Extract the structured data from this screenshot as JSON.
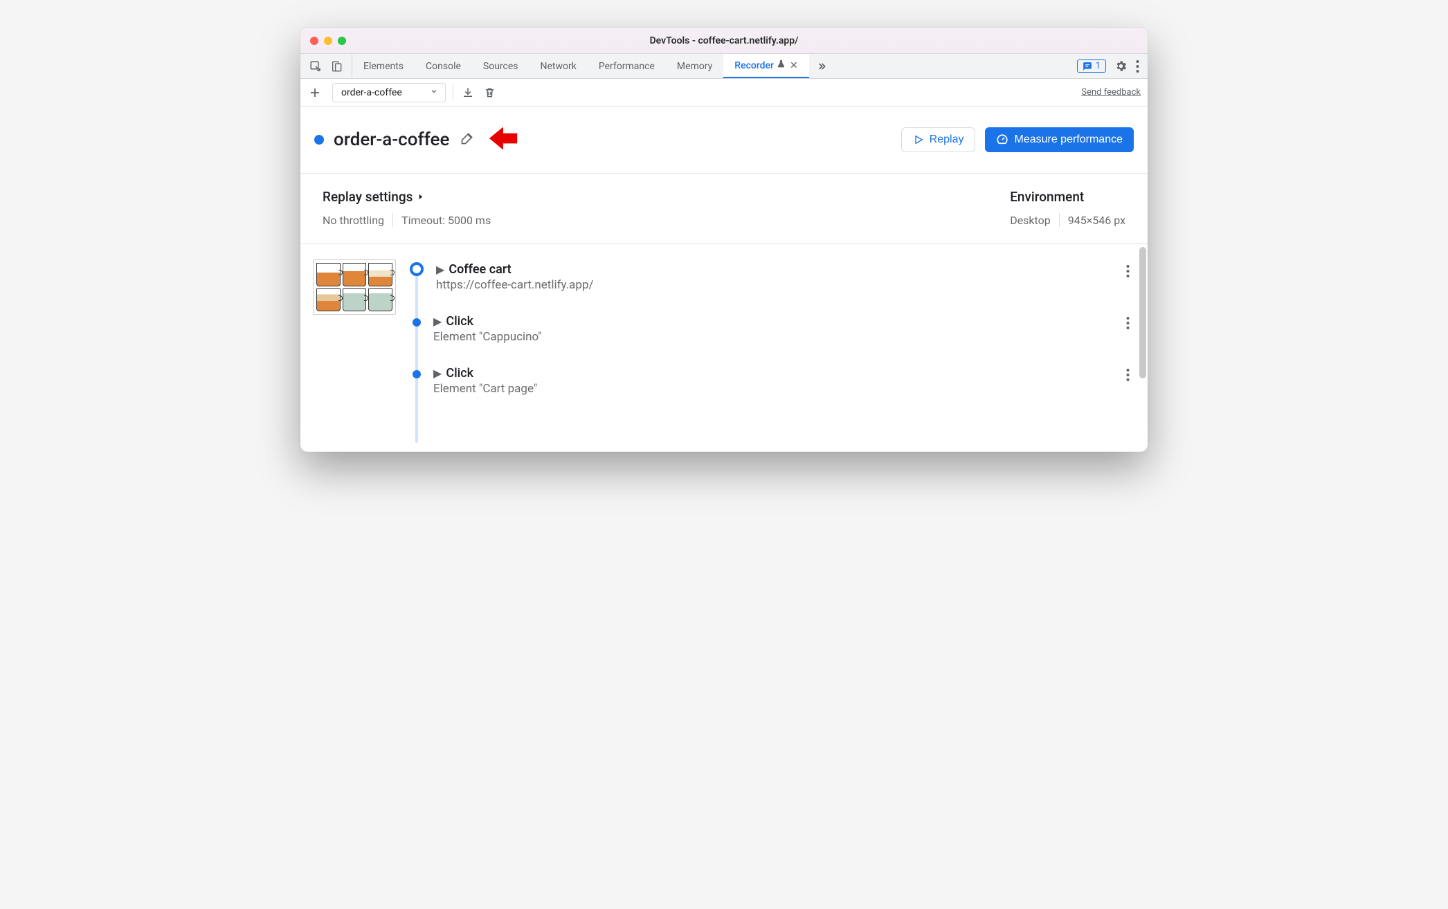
{
  "window": {
    "title": "DevTools - coffee-cart.netlify.app/"
  },
  "tabs": {
    "items": [
      "Elements",
      "Console",
      "Sources",
      "Network",
      "Performance",
      "Memory",
      "Recorder"
    ],
    "activeIndex": 6,
    "issuesCount": "1"
  },
  "toolbar": {
    "recordingName": "order-a-coffee",
    "sendFeedback": "Send feedback"
  },
  "header": {
    "title": "order-a-coffee",
    "replayLabel": "Replay",
    "measureLabel": "Measure performance"
  },
  "settings": {
    "replayHeading": "Replay settings",
    "throttling": "No throttling",
    "timeout": "Timeout: 5000 ms",
    "envHeading": "Environment",
    "device": "Desktop",
    "viewport": "945×546 px"
  },
  "steps": [
    {
      "title": "Coffee cart",
      "sub": "https://coffee-cart.netlify.app/",
      "big": true
    },
    {
      "title": "Click",
      "sub": "Element \"Cappucino\"",
      "big": false
    },
    {
      "title": "Click",
      "sub": "Element \"Cart page\"",
      "big": false
    }
  ]
}
